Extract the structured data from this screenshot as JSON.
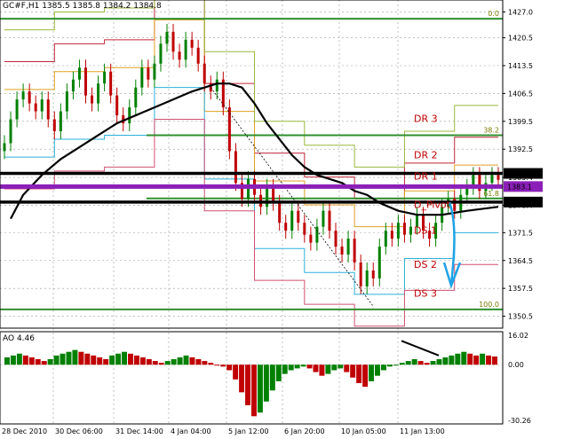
{
  "symbol": {
    "header": "GC#F,H1  1385.5 1385.8 1384.2 1384.8",
    "indicator": "AO 4.46"
  },
  "colors": {
    "up_bar": "#008000",
    "down_bar": "#c00000",
    "fib": "#2f8f2f",
    "pivot_purple": "#8b1fb8",
    "arrow": "#1fa3e6"
  },
  "chart_data": [
    {
      "type": "candlestick",
      "title": "GC#F,H1  1385.5 1385.8 1384.2 1384.8",
      "ylim": [
        1347.5,
        1430.0
      ],
      "y_ticks": [
        "1427.0",
        "1420.5",
        "1413.5",
        "1406.5",
        "1399.5",
        "1392.5",
        "1385.4",
        "1378.4",
        "1371.5",
        "1364.5",
        "1357.5",
        "1350.5"
      ],
      "x_ticks": [
        "28 Dec 2010",
        "30 Dec 06:00",
        "31 Dec 14:00",
        "4 Jan 04:00",
        "5 Jan 12:00",
        "6 Jan 20:00",
        "10 Jan 05:00",
        "11 Jan 13:00"
      ],
      "price_labels": [
        {
          "text": "1386.4",
          "value": 1386.4,
          "style": "black"
        },
        {
          "text": "1383.1",
          "value": 1383.1,
          "style": "purple"
        },
        {
          "text": "1379.2",
          "value": 1379.2,
          "style": "black"
        }
      ],
      "levels": [
        {
          "label": "DR 3",
          "value": 1400.2
        },
        {
          "label": "DR 2",
          "value": 1391.1
        },
        {
          "label": "DR 1",
          "value": 1385.7
        },
        {
          "label": "D_Pivot",
          "value": 1378.6
        },
        {
          "label": "DS 1",
          "value": 1372.1
        },
        {
          "label": "DS 2",
          "value": 1363.5
        },
        {
          "label": "DS 3",
          "value": 1356.3
        }
      ],
      "fib_levels": [
        {
          "label": "0.0",
          "value": 1425.3
        },
        {
          "label": "38.2",
          "value": 1396.0
        },
        {
          "label": "61.8",
          "value": 1380.1
        },
        {
          "label": "100.0",
          "value": 1352.2
        }
      ],
      "closes": [
        1394,
        1400,
        1405,
        1407,
        1404,
        1402,
        1405,
        1400,
        1397,
        1402,
        1407,
        1410,
        1413,
        1406,
        1404,
        1409,
        1412,
        1406,
        1401,
        1399,
        1403,
        1408,
        1413,
        1410,
        1414,
        1419,
        1422,
        1417,
        1415,
        1420,
        1418,
        1414,
        1409,
        1407,
        1410,
        1403,
        1392,
        1384,
        1380,
        1385,
        1381,
        1378,
        1383,
        1379,
        1374,
        1372,
        1377,
        1374,
        1371,
        1369,
        1373,
        1377,
        1372,
        1368,
        1366,
        1370,
        1364,
        1358,
        1362,
        1360,
        1368,
        1372,
        1370,
        1374,
        1371,
        1373,
        1376,
        1372,
        1370,
        1374,
        1378,
        1380,
        1377,
        1381,
        1383,
        1386,
        1382,
        1384,
        1386,
        1384.8
      ],
      "moving_average": [
        1375,
        1381,
        1386,
        1390,
        1393,
        1396,
        1399,
        1401,
        1403,
        1405,
        1407,
        1408,
        1409,
        1409,
        1408,
        1404,
        1399,
        1395,
        1391,
        1388,
        1386,
        1385,
        1384,
        1382,
        1381,
        1379,
        1377,
        1376,
        1376,
        1377,
        1378
      ],
      "ma_x": [
        1,
        3,
        6,
        9,
        12,
        15,
        18,
        21,
        24,
        27,
        30,
        32,
        34,
        36,
        38,
        40,
        42,
        44,
        46,
        48,
        50,
        52,
        54,
        56,
        58,
        60,
        63,
        66,
        70,
        74,
        79
      ]
    },
    {
      "type": "bar",
      "title": "AO 4.46",
      "ylim": [
        -30.26,
        16.02
      ],
      "y_ticks": [
        "16.02",
        "0.00",
        "-30.26"
      ],
      "values": [
        4,
        5,
        6,
        5,
        4,
        3,
        2,
        3,
        5,
        6,
        7,
        8,
        7,
        6,
        5,
        4,
        3,
        5,
        6,
        7,
        6,
        5,
        4,
        3,
        2,
        1,
        2,
        3,
        4,
        5,
        4,
        3,
        2,
        1,
        0,
        -1,
        -3,
        -8,
        -15,
        -22,
        -28,
        -26,
        -20,
        -14,
        -9,
        -5,
        -3,
        -2,
        -1,
        -2,
        -4,
        -6,
        -5,
        -3,
        -2,
        -4,
        -7,
        -10,
        -12,
        -9,
        -6,
        -3,
        -1,
        0,
        1,
        2,
        3,
        2,
        1,
        2,
        3,
        4,
        5,
        6,
        7,
        6,
        5,
        6,
        5,
        4.46
      ]
    }
  ]
}
